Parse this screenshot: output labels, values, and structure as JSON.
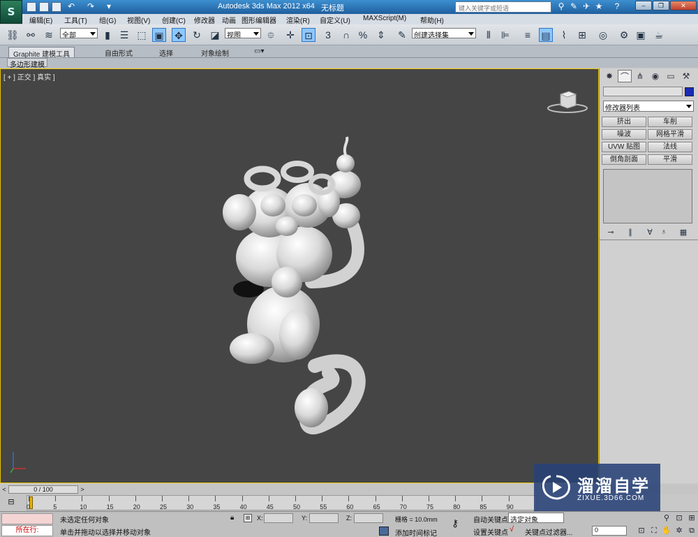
{
  "titlebar": {
    "app_logo": "S",
    "title": "Autodesk 3ds Max  2012 x64",
    "document": "无标题",
    "help_search_placeholder": "键入关键字或短语"
  },
  "menu": {
    "items": [
      "编辑(E)",
      "工具(T)",
      "组(G)",
      "视图(V)",
      "创建(C)",
      "修改器",
      "动画",
      "图形编辑器",
      "渲染(R)",
      "自定义(U)",
      "MAXScript(M)",
      "帮助(H)"
    ]
  },
  "toolbar": {
    "selection_filter": "全部",
    "reference_coord": "视图",
    "named_selection": "创建选择集",
    "snap_label": "3"
  },
  "ribbon": {
    "tabs": [
      "Graphite 建模工具",
      "自由形式",
      "选择",
      "对象绘制"
    ],
    "sub_label": "多边形建模"
  },
  "viewport": {
    "label": "[ + ] 正交 ] 真实 ]"
  },
  "command_panel": {
    "modifier_list": "修改器列表",
    "modifier_buttons": [
      "挤出",
      "车削",
      "噪波",
      "网格平滑",
      "UVW 贴图",
      "法线",
      "倒角剖面",
      "平滑"
    ],
    "object_color": "#1c2bb5"
  },
  "timeline": {
    "frame_display": "0 / 100",
    "ticks": [
      "0",
      "5",
      "10",
      "15",
      "20",
      "25",
      "30",
      "35",
      "40",
      "45",
      "50",
      "55",
      "60",
      "65",
      "70",
      "75",
      "80",
      "85",
      "90"
    ]
  },
  "statusbar": {
    "running": "所在行:",
    "status1": "未选定任何对象",
    "status2": "单击并拖动以选择并移动对象",
    "x_label": "X:",
    "y_label": "Y:",
    "z_label": "Z:",
    "grid": "栅格 = 10.0mm",
    "add_time_tag": "添加时间标记",
    "auto_key": "自动关键点",
    "set_key": "设置关键点",
    "selection_set": "选定对象",
    "key_filters": "关键点过滤器...",
    "current_frame": "0"
  },
  "watermark": {
    "title": "溜溜自学",
    "url": "ZIXUE.3D66.COM"
  }
}
